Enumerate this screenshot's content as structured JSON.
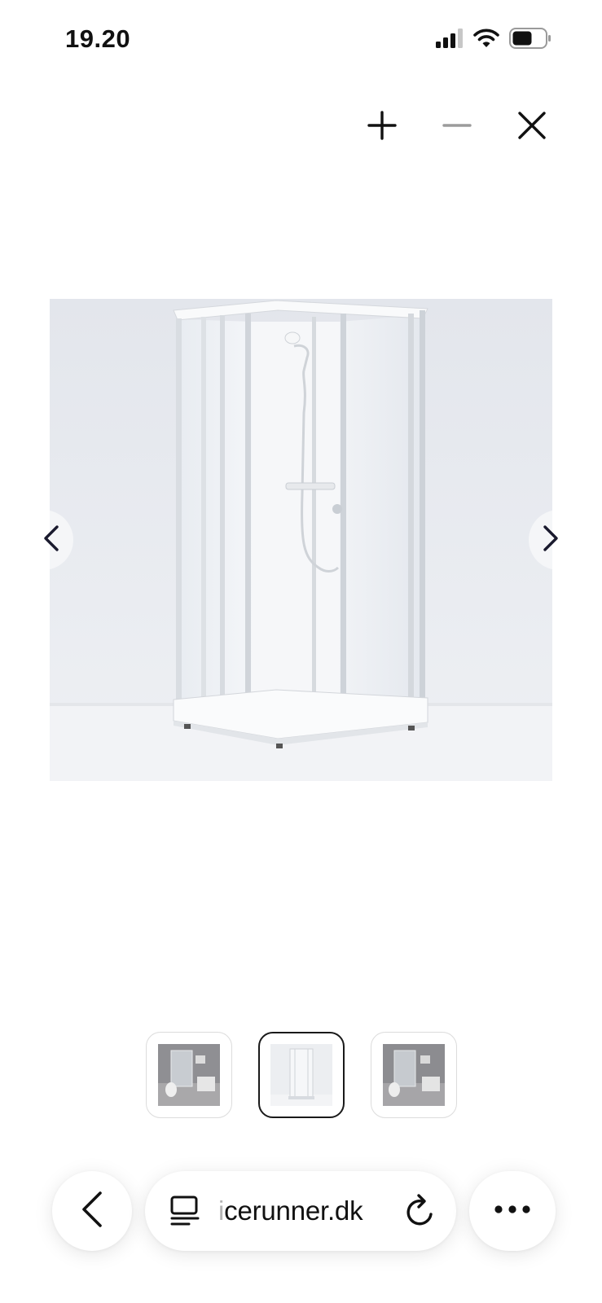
{
  "status_bar": {
    "time": "19.20",
    "icons": [
      "cellular-signal-icon",
      "wifi-icon",
      "battery-icon"
    ]
  },
  "viewer_controls": {
    "icons": [
      "plus-icon",
      "minus-icon",
      "close-icon"
    ],
    "zoom_out_disabled": true
  },
  "gallery": {
    "main_image": "shower-cabin-photo",
    "nav_icons": [
      "chevron-left-icon",
      "chevron-right-icon"
    ],
    "thumbnails": [
      {
        "image": "bathroom-scene-photo",
        "selected": false
      },
      {
        "image": "shower-cabin-photo",
        "selected": true
      },
      {
        "image": "bathroom-scene-photo",
        "selected": false
      }
    ]
  },
  "browser_toolbar": {
    "url_faded_prefix": "i",
    "url_main": "cerunner.dk",
    "icons": [
      "back-arrow-icon",
      "reader-mode-icon",
      "reload-icon",
      "more-options-icon"
    ]
  }
}
